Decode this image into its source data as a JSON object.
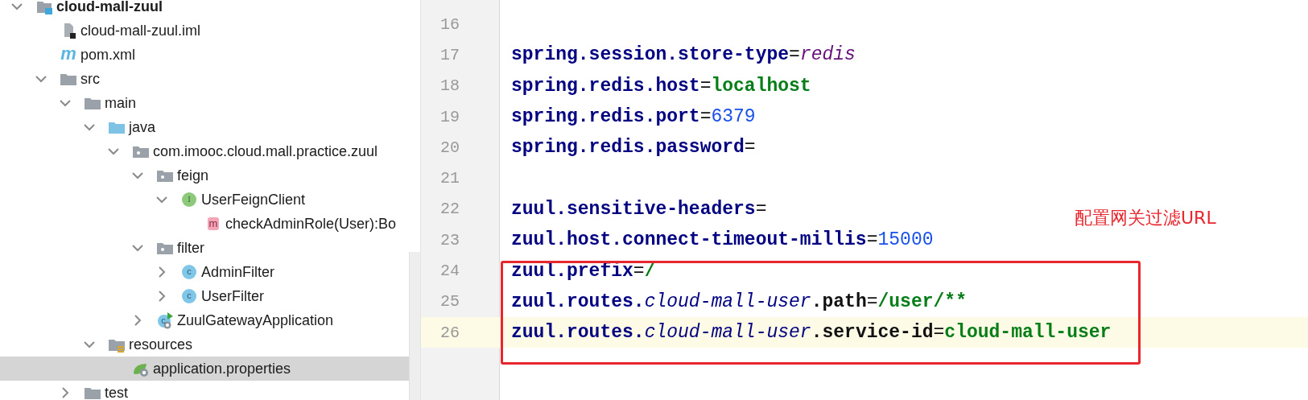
{
  "project_tree": [
    {
      "label": "cloud-mall-zuul",
      "kind": "module",
      "expanded": true,
      "selected": false,
      "children": [
        {
          "label": "cloud-mall-zuul.iml",
          "kind": "iml",
          "selected": false
        },
        {
          "label": "pom.xml",
          "kind": "maven",
          "icon_label": "m",
          "selected": false
        },
        {
          "label": "src",
          "kind": "folder",
          "expanded": true,
          "selected": false,
          "children": [
            {
              "label": "main",
              "kind": "folder",
              "expanded": true,
              "selected": false,
              "children": [
                {
                  "label": "java",
                  "kind": "source-folder",
                  "expanded": true,
                  "selected": false,
                  "children": [
                    {
                      "label": "com.imooc.cloud.mall.practice.zuul",
                      "kind": "package",
                      "expanded": true,
                      "selected": false,
                      "children": [
                        {
                          "label": "feign",
                          "kind": "package",
                          "expanded": true,
                          "selected": false,
                          "children": [
                            {
                              "label": "UserFeignClient",
                              "kind": "interface",
                              "icon_label": "I",
                              "expanded": true,
                              "selected": false,
                              "children": [
                                {
                                  "label": "checkAdminRole(User):Bo",
                                  "kind": "method",
                                  "icon_label": "m",
                                  "selected": false
                                }
                              ]
                            }
                          ]
                        },
                        {
                          "label": "filter",
                          "kind": "package",
                          "expanded": true,
                          "selected": false,
                          "children": [
                            {
                              "label": "AdminFilter",
                              "kind": "class",
                              "icon_label": "c",
                              "expanded": false,
                              "selected": false
                            },
                            {
                              "label": "UserFilter",
                              "kind": "class",
                              "icon_label": "c",
                              "expanded": false,
                              "selected": false
                            }
                          ]
                        },
                        {
                          "label": "ZuulGatewayApplication",
                          "kind": "boot-class",
                          "icon_label": "c",
                          "expanded": false,
                          "selected": false
                        }
                      ]
                    }
                  ]
                },
                {
                  "label": "resources",
                  "kind": "resources-folder",
                  "expanded": true,
                  "selected": false,
                  "children": [
                    {
                      "label": "application.properties",
                      "kind": "properties",
                      "selected": true
                    }
                  ]
                }
              ]
            },
            {
              "label": "test",
              "kind": "folder",
              "expanded": false,
              "selected": false
            }
          ]
        }
      ]
    }
  ],
  "editor": {
    "lines": [
      {
        "number": "16",
        "current": false
      },
      {
        "number": "17",
        "current": false,
        "tokens": [
          {
            "kind": "key",
            "text": "spring.session.store-type"
          },
          {
            "kind": "sep",
            "text": "="
          },
          {
            "kind": "enum",
            "text": "redis"
          }
        ]
      },
      {
        "number": "18",
        "current": false,
        "tokens": [
          {
            "kind": "key",
            "text": "spring.redis.host"
          },
          {
            "kind": "sep",
            "text": "="
          },
          {
            "kind": "string",
            "text": "localhost"
          }
        ]
      },
      {
        "number": "19",
        "current": false,
        "tokens": [
          {
            "kind": "key",
            "text": "spring.redis.port"
          },
          {
            "kind": "sep",
            "text": "="
          },
          {
            "kind": "number",
            "text": "6379"
          }
        ]
      },
      {
        "number": "20",
        "current": false,
        "tokens": [
          {
            "kind": "key",
            "text": "spring.redis.password"
          },
          {
            "kind": "sep",
            "text": "="
          }
        ]
      },
      {
        "number": "21",
        "current": false
      },
      {
        "number": "22",
        "current": false,
        "tokens": [
          {
            "kind": "key",
            "text": "zuul.sensitive-headers"
          },
          {
            "kind": "sep",
            "text": "="
          }
        ]
      },
      {
        "number": "23",
        "current": false,
        "tokens": [
          {
            "kind": "key",
            "text": "zuul.host.connect-timeout-millis"
          },
          {
            "kind": "sep",
            "text": "="
          },
          {
            "kind": "number",
            "text": "15000"
          }
        ]
      },
      {
        "number": "24",
        "current": false,
        "tokens": [
          {
            "kind": "key",
            "text": "zuul.prefix"
          },
          {
            "kind": "sep",
            "text": "="
          },
          {
            "kind": "string",
            "text": "/"
          }
        ]
      },
      {
        "number": "25",
        "current": false,
        "tokens": [
          {
            "kind": "key",
            "text": "zuul.routes."
          },
          {
            "kind": "key-italic",
            "text": "cloud-mall-user"
          },
          {
            "kind": "key-plain",
            "text": ".path"
          },
          {
            "kind": "sep",
            "text": "="
          },
          {
            "kind": "string",
            "text": "/user/**"
          }
        ]
      },
      {
        "number": "26",
        "current": true,
        "tokens": [
          {
            "kind": "key",
            "text": "zuul.routes."
          },
          {
            "kind": "key-italic",
            "text": "cloud-mall-user"
          },
          {
            "kind": "key-plain",
            "text": ".service-id"
          },
          {
            "kind": "sep",
            "text": "="
          },
          {
            "kind": "string",
            "text": "cloud-mall-user"
          }
        ]
      }
    ],
    "annotation": "配置网关过滤URL"
  }
}
